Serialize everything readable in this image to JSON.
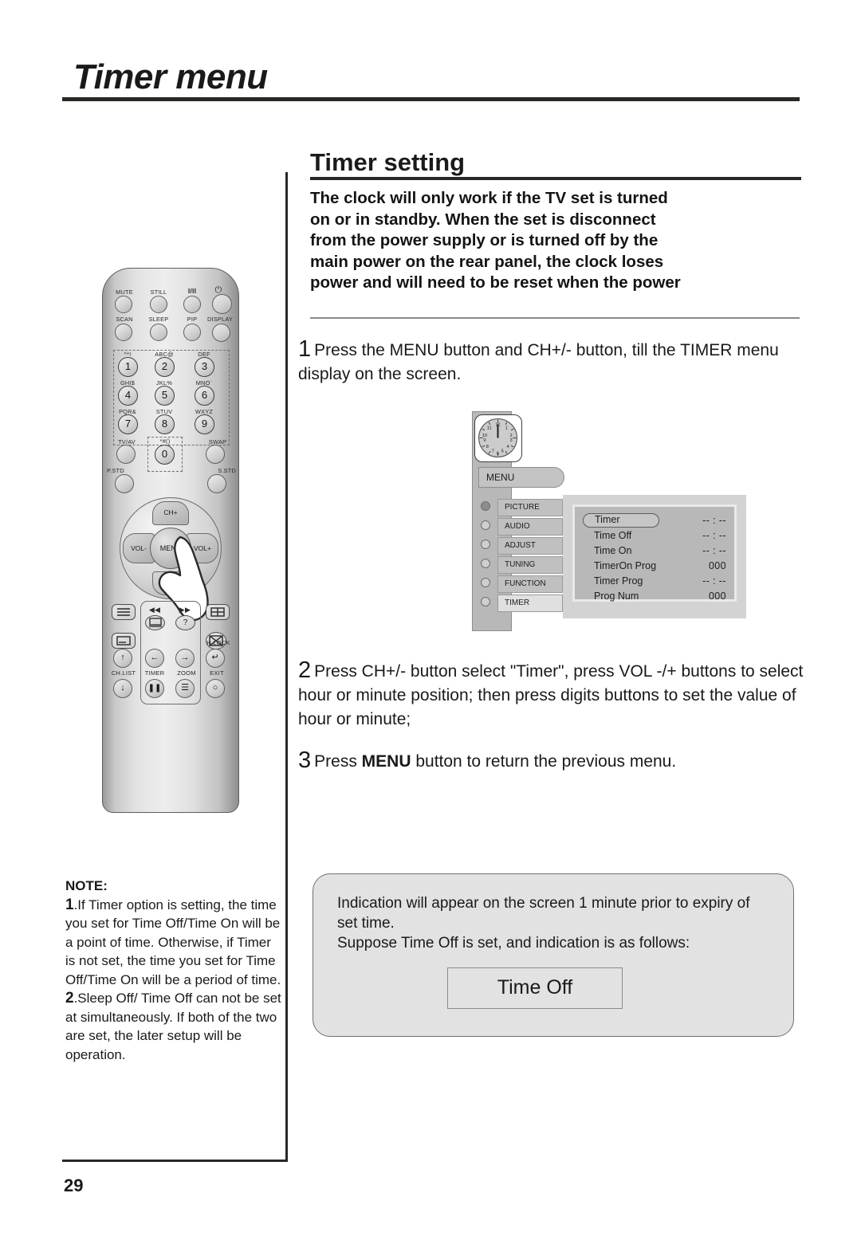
{
  "page": {
    "title": "Timer menu",
    "number": "29"
  },
  "section": {
    "title": "Timer setting",
    "warning_lines": [
      "The  clock  will  only  work  if  the  TV set  is   turned",
      "on  or  in  standby.  When  the  set  is  disconnect",
      "from  the  power  supply  or  is turned  off  by  the",
      "main  power  on  the  rear  panel,  the  clock  loses",
      "power and will need to be reset when the power"
    ]
  },
  "steps": [
    {
      "number": "1",
      "text": "Press the MENU button and CH+/- button, till the TIMER menu display on the screen."
    },
    {
      "number": "2",
      "text": "Press  CH+/-  button select \"Timer\", press  VOL -/+ buttons  to  select hour  or  minute position; then press digits buttons to set the value of hour or minute;"
    },
    {
      "number": "3",
      "text_before": "Press ",
      "bold": "MENU",
      "text_after": " button to return the previous menu."
    }
  ],
  "remote": {
    "row1": [
      "MUTE",
      "STILL",
      "I/II",
      "power-symbol"
    ],
    "row2": [
      "SCAN",
      "SLEEP",
      "PIP",
      "DISPLAY"
    ],
    "keypad": [
      {
        "letters": "^*!",
        "digit": "1"
      },
      {
        "letters": "ABC@",
        "digit": "2"
      },
      {
        "letters": "DEF",
        "digit": "3"
      },
      {
        "letters": "GHI$",
        "digit": "4"
      },
      {
        "letters": "JKL%",
        "digit": "5"
      },
      {
        "letters": "MNO`",
        "digit": "6"
      },
      {
        "letters": "PQR&",
        "digit": "7"
      },
      {
        "letters": "STUV",
        "digit": "8"
      },
      {
        "letters": "WXYZ",
        "digit": "9"
      }
    ],
    "zero_letters": "*#()",
    "zero_digit": "0",
    "tv_av": "TV/AV",
    "swap": "SWAP",
    "pstd": "P.STD",
    "sstd": "S.STD",
    "dpad": {
      "up": "CH+",
      "down": "CH-",
      "left": "VOL-",
      "right": "VOL+",
      "center": "MENU"
    },
    "bottom_labels": {
      "ch_list": "CH.LIST",
      "timer": "TIMER",
      "zoom": "ZOOM",
      "h_lock": "H.LOCK",
      "exit": "EXIT"
    }
  },
  "osd": {
    "menu_label": "MENU",
    "categories": [
      {
        "label": "PICTURE",
        "selected_dot": true
      },
      {
        "label": "AUDIO",
        "selected_dot": false
      },
      {
        "label": "ADJUST",
        "selected_dot": false
      },
      {
        "label": "TUNING",
        "selected_dot": false
      },
      {
        "label": "FUNCTION",
        "selected_dot": false
      },
      {
        "label": "TIMER",
        "selected_dot": false
      }
    ],
    "rows": [
      {
        "label": "Timer",
        "value": "-- : --",
        "highlighted": true
      },
      {
        "label": "Time Off",
        "value": "-- : --",
        "highlighted": false
      },
      {
        "label": "Time On",
        "value": "-- : --",
        "highlighted": false
      },
      {
        "label": "TimerOn Prog",
        "value": "000",
        "highlighted": false
      },
      {
        "label": "Timer Prog",
        "value": "-- : --",
        "highlighted": false
      },
      {
        "label": "Prog Num",
        "value": "000",
        "highlighted": false
      }
    ]
  },
  "note": {
    "heading": "NOTE:",
    "items": [
      {
        "num": "1",
        "text": ".If Timer option is setting, the time you set for Time Off/Time On will be a point of time. Otherwise, if Timer is not set, the time you set for Time Off/Time On will be a period of time."
      },
      {
        "num": "2",
        "text": ".Sleep Off/ Time Off can not be set at simultaneously. If both of the two are set, the later setup will be operation."
      }
    ]
  },
  "indication": {
    "line1": "Indication will appear on the screen 1 minute prior to expiry of set time.",
    "line2": "Suppose Time Off is set, and indication is as follows:",
    "chip_label": "Time Off"
  },
  "colors": {
    "ink": "#1a1a1a",
    "rule": "#2b2722",
    "panel": "#b8b8b8",
    "box": "#e2e2e2"
  }
}
